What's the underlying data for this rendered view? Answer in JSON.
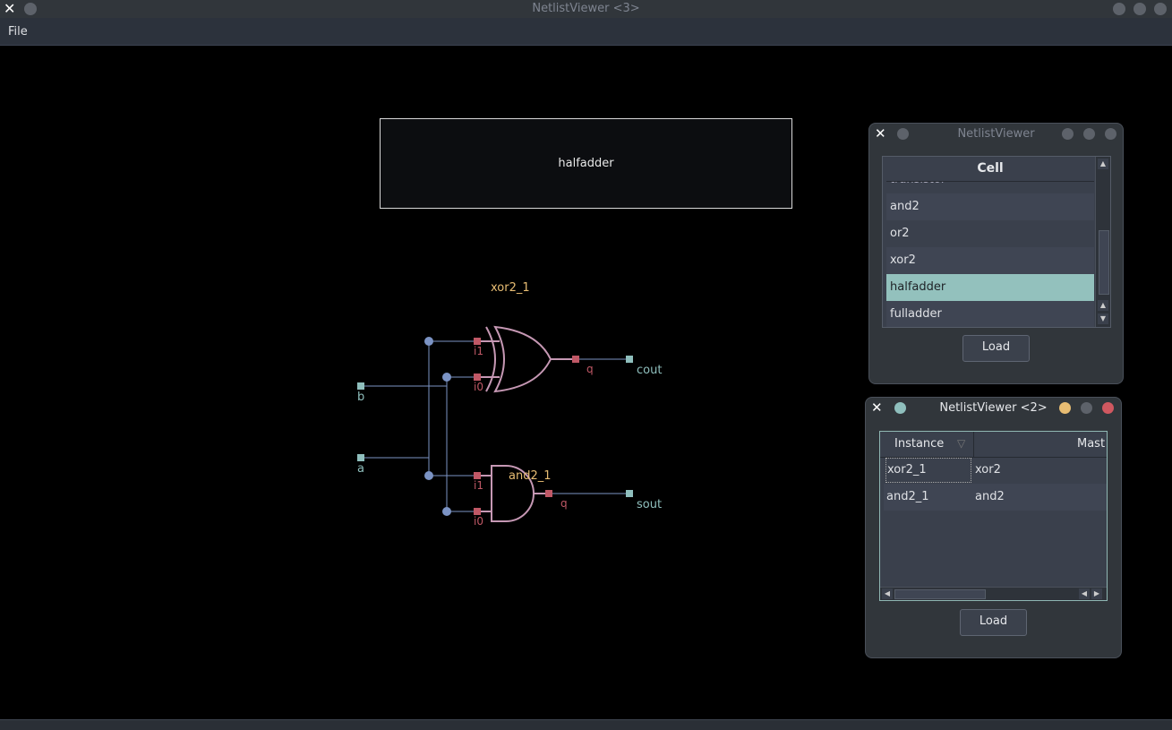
{
  "main_window": {
    "title": "NetlistViewer <3>",
    "menu": {
      "file": "File"
    }
  },
  "canvas": {
    "cell_name": "halfadder",
    "instances": [
      {
        "name": "xor2_1",
        "pins": [
          "i1",
          "i0",
          "q"
        ]
      },
      {
        "name": "and2_1",
        "pins": [
          "i1",
          "i0",
          "q"
        ]
      }
    ],
    "ports": [
      "b",
      "a",
      "cout",
      "sout"
    ],
    "colors": {
      "wire": "#7b93c4",
      "gate": "#c698b4",
      "pin": "#c05866",
      "port": "#8fbfbd",
      "instance_label": "#e8bd73"
    }
  },
  "cell_window": {
    "title": "NetlistViewer",
    "header": "Cell",
    "items": [
      "transistor",
      "and2",
      "or2",
      "xor2",
      "halfadder",
      "fulladder"
    ],
    "selected": "halfadder",
    "load_label": "Load"
  },
  "instance_window": {
    "title": "NetlistViewer <2>",
    "columns": [
      "Instance",
      "Mast"
    ],
    "rows": [
      {
        "instance": "xor2_1",
        "master": "xor2"
      },
      {
        "instance": "and2_1",
        "master": "and2"
      }
    ],
    "load_label": "Load"
  }
}
